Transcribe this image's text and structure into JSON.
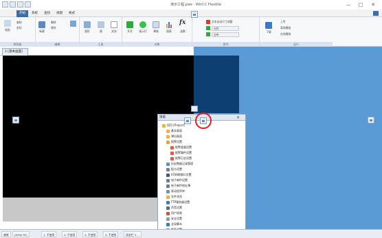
{
  "titlebar": {
    "title": "演示工程.pwe - WinCC Flexible",
    "controls": [
      "—",
      "□",
      "✕"
    ]
  },
  "ribbon_tabs": [
    {
      "label": "开始",
      "active": true
    },
    {
      "label": "系统",
      "active": false
    },
    {
      "label": "查找",
      "active": false
    },
    {
      "label": "视图",
      "active": false
    },
    {
      "label": "格式",
      "active": false
    }
  ],
  "ribbon_groups": [
    {
      "label": "剪贴板",
      "items": [
        "粘贴",
        "复制",
        "剪切"
      ]
    },
    {
      "label": "编辑",
      "items": [
        "新建",
        "删除",
        "属性"
      ]
    },
    {
      "label": "工具",
      "items": [
        "图形",
        "图",
        "文本"
      ]
    },
    {
      "label": "对象",
      "items": [
        "开关",
        "指示灯",
        "棒图",
        "图表",
        "函数"
      ]
    },
    {
      "label": "排列",
      "items": [
        "文本自动尺寸调整",
        "对齐",
        "分布"
      ]
    },
    {
      "label": "运行",
      "items": [
        "下载",
        "上传",
        "离线模拟",
        "在线模拟"
      ]
    }
  ],
  "doc_tab": {
    "label": "1 [基本画面]"
  },
  "pane": {
    "title": "项目",
    "tree": [
      "项目 [Project]",
      "基本画面",
      "弹出画面",
      "报警设置",
      "报警变量设置",
      "报警事件设置",
      "报警日志设置",
      "历史数据记录管理",
      "配方设置",
      "I/O网络端口设置",
      "电子邮件设置",
      "电子邮件地址薄",
      "驱动程序库",
      "文件浏览",
      "FTP服务器设置",
      "声音设置",
      "用户权限",
      "安全设置",
      "全局脚本",
      "颜色设置",
      "图片管理器"
    ]
  },
  "status": {
    "cells": [
      "就绪",
      "[HMI0 RT]",
      "1: 不使用",
      "2: 不使用",
      "3: 不使用",
      "4: 不使用",
      "状态栏 5 ..."
    ]
  },
  "colors": {
    "canvas": "#000000",
    "dock_blue": "#5b9bd5",
    "navy": "#0e3f73",
    "highlight": "#e0191b"
  }
}
